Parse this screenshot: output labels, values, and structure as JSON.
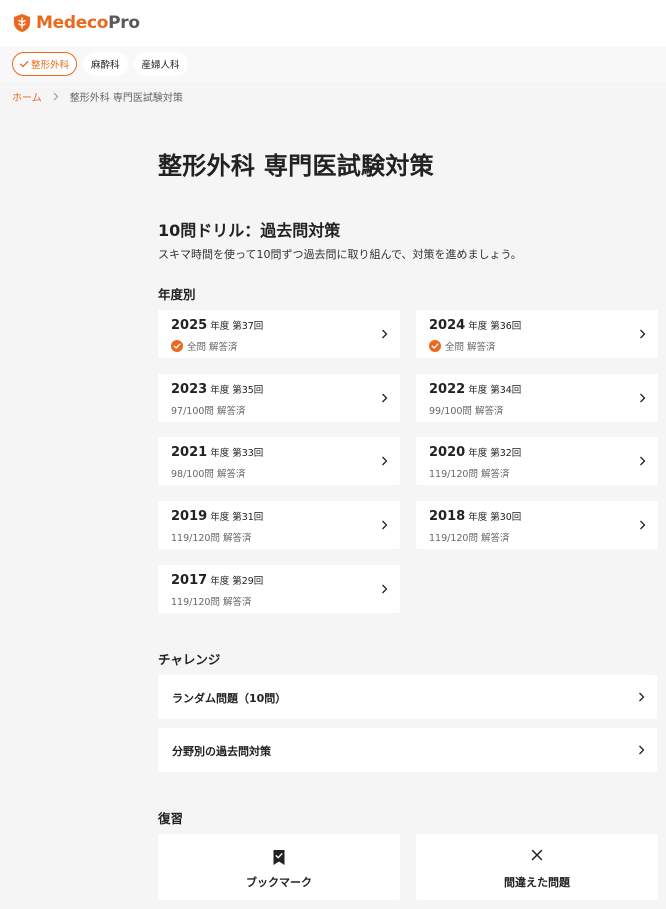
{
  "header": {
    "logo_a": "Medeco",
    "logo_b": "Pro"
  },
  "chips": [
    {
      "label": "整形外科",
      "active": true
    },
    {
      "label": "麻酔科",
      "active": false
    },
    {
      "label": "産婦人科",
      "active": false
    }
  ],
  "breadcrumb": {
    "home": "ホーム",
    "current": "整形外科 専門医試験対策"
  },
  "page_title": "整形外科 専門医試験対策",
  "drill": {
    "title": "10問ドリル：過去問対策",
    "desc": "スキマ時間を使って10問ずつ過去問に取り組んで、対策を進めましょう。"
  },
  "sections": {
    "yearly": "年度別",
    "challenge": "チャレンジ",
    "review": "復習"
  },
  "years": [
    {
      "year": "2025",
      "sub": "年度 第37回",
      "status": "全問 解答済",
      "complete": true
    },
    {
      "year": "2024",
      "sub": "年度 第36回",
      "status": "全問 解答済",
      "complete": true
    },
    {
      "year": "2023",
      "sub": "年度 第35回",
      "status": "97/100問 解答済",
      "complete": false
    },
    {
      "year": "2022",
      "sub": "年度 第34回",
      "status": "99/100問 解答済",
      "complete": false
    },
    {
      "year": "2021",
      "sub": "年度 第33回",
      "status": "98/100問 解答済",
      "complete": false
    },
    {
      "year": "2020",
      "sub": "年度 第32回",
      "status": "119/120問 解答済",
      "complete": false
    },
    {
      "year": "2019",
      "sub": "年度 第31回",
      "status": "119/120問 解答済",
      "complete": false
    },
    {
      "year": "2018",
      "sub": "年度 第30回",
      "status": "119/120問 解答済",
      "complete": false
    },
    {
      "year": "2017",
      "sub": "年度 第29回",
      "status": "119/120問 解答済",
      "complete": false
    }
  ],
  "challenge": [
    {
      "label": "ランダム問題（10問）"
    },
    {
      "label": "分野別の過去問対策"
    }
  ],
  "review": {
    "bookmark": "ブックマーク",
    "mistakes": "間違えた問題"
  },
  "colors": {
    "accent": "#ea6a1d",
    "text": "#222222",
    "bg": "#f5f5f5"
  }
}
